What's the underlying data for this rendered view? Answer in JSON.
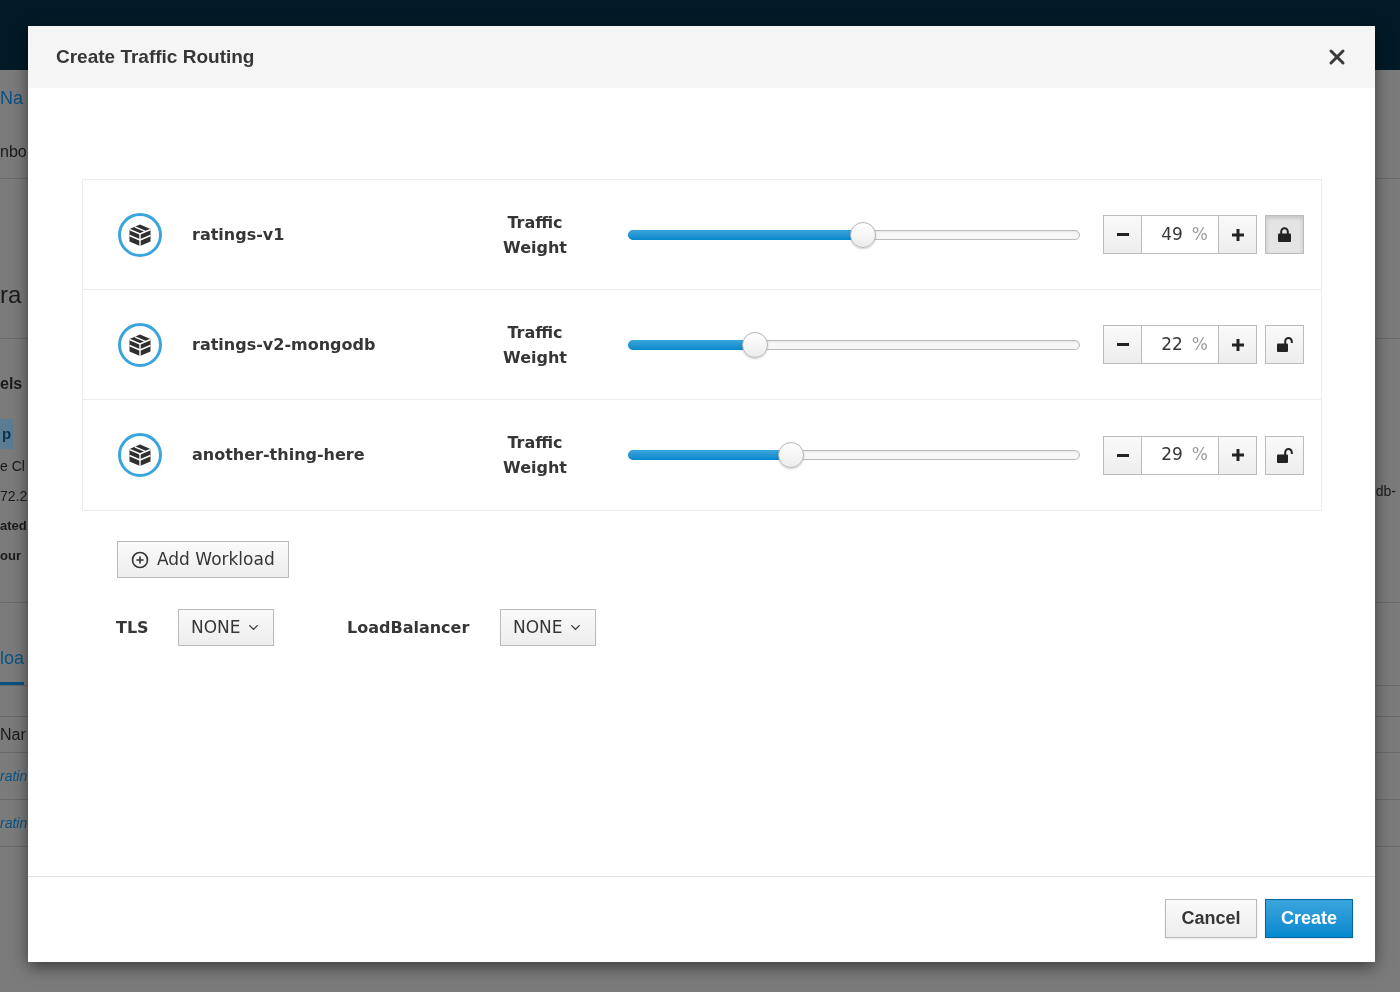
{
  "background_page": {
    "breadcrumb": "Na",
    "subtitle": "nbo",
    "heading": "ra",
    "section_label": "els",
    "tags": [
      "p"
    ],
    "details": [
      {
        "kind": "text",
        "text": "e Cl"
      },
      {
        "kind": "text",
        "text": "72.2"
      },
      {
        "kind": "label",
        "text": "ated"
      },
      {
        "kind": "label",
        "text": "our"
      }
    ],
    "right_fragment": "db-",
    "tab": {
      "label": "loa",
      "selected": true
    },
    "table": {
      "column_1": "Nar",
      "rows": [
        "ratin",
        "ratin"
      ]
    }
  },
  "dialog": {
    "title": "Create Traffic Routing",
    "workloads": [
      {
        "name": "ratings-v1",
        "weight_label": "Traffic Weight",
        "level": 0.52,
        "value": "49",
        "unit": "%",
        "locked": true
      },
      {
        "name": "ratings-v2-mongodb",
        "weight_label": "Traffic Weight",
        "level": 0.28,
        "value": "22",
        "unit": "%",
        "locked": false
      },
      {
        "name": "another-thing-here",
        "weight_label": "Traffic Weight",
        "level": 0.36,
        "value": "29",
        "unit": "%",
        "locked": false
      }
    ],
    "add_button": "Add Workload",
    "settings": [
      {
        "label": "TLS",
        "value": "NONE"
      },
      {
        "label": "LoadBalancer",
        "value": "NONE"
      }
    ],
    "buttons": [
      {
        "kind": "secondary",
        "label": "Cancel"
      },
      {
        "kind": "primary",
        "label": "Create"
      }
    ]
  }
}
